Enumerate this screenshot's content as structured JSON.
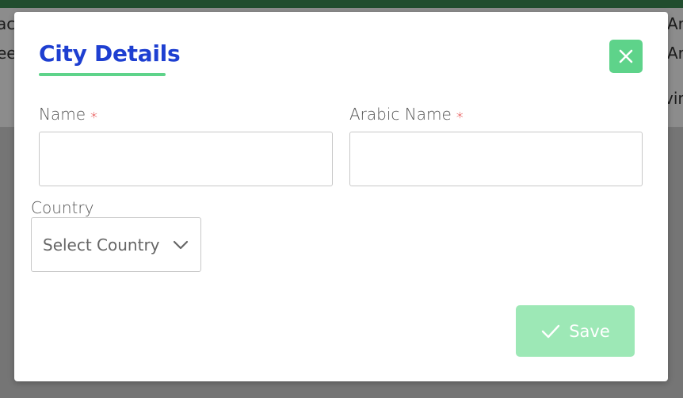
{
  "background": {
    "row1_left": "ac",
    "row2_left": "ee",
    "row1_right": "Ar",
    "row2_right": "Ar",
    "row3_right": "vin"
  },
  "modal": {
    "title": "City Details",
    "close_icon": "close-icon",
    "fields": {
      "name_label": "Name",
      "arabic_name_label": "Arabic Name",
      "required_marker": "*",
      "name_value": "",
      "arabic_name_value": "",
      "country_label": "Country",
      "country_selected": "Select Country"
    },
    "save_label": "Save"
  },
  "colors": {
    "title": "#1e3fd1",
    "accent_green": "#5ed38a",
    "save_disabled": "#9de8b6",
    "required": "#e02020",
    "topbar": "#3c8d55"
  }
}
